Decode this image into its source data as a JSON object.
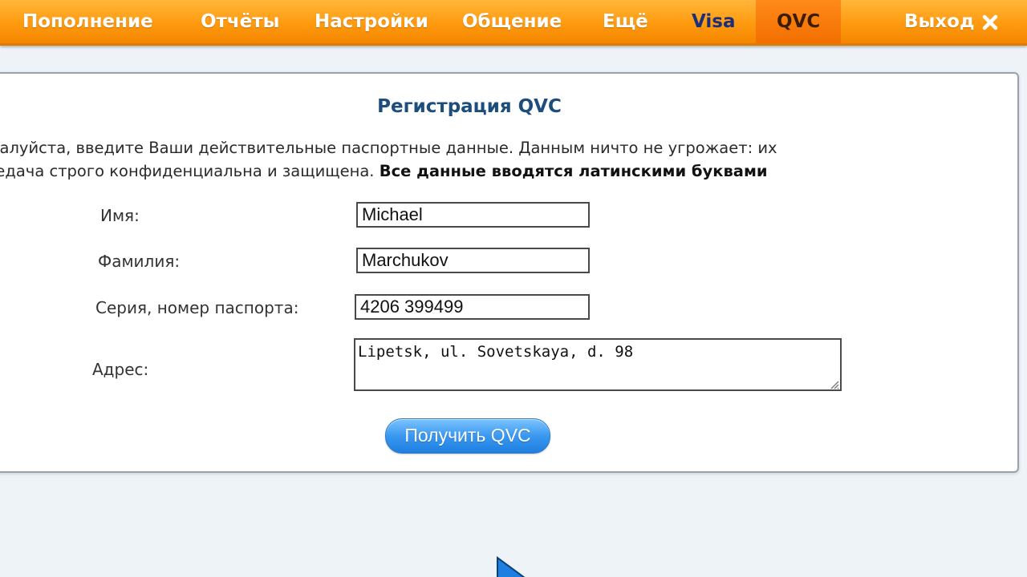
{
  "nav": {
    "items": [
      {
        "label": "Пополнение"
      },
      {
        "label": "Отчёты"
      },
      {
        "label": "Настройки"
      },
      {
        "label": "Общение"
      },
      {
        "label": "Ещё"
      },
      {
        "label": "Visa"
      },
      {
        "label": "QVC",
        "active": true
      }
    ],
    "exit_label": "Выход"
  },
  "form": {
    "title": "Регистрация QVC",
    "desc_line1": "ожалуйста, введите Ваши действительные паспортные данные. Данным ничто не угрожает: их",
    "desc_line2": "ередача строго конфиденциальна и защищена.",
    "desc_bold": "Все данные вводятся латинскими буквами",
    "fields": {
      "first_name": {
        "label": "Имя:",
        "value": "Michael"
      },
      "last_name": {
        "label": "Фамилия:",
        "value": "Marchukov"
      },
      "passport": {
        "label": "Серия, номер паспорта:",
        "value": "4206 399499"
      },
      "address": {
        "label": "Адрес:",
        "value": "Lipetsk, ul. Sovetskaya, d. 98"
      }
    },
    "submit_label": "Получить QVC"
  },
  "colors": {
    "nav_orange": "#ff9a0f",
    "title_blue": "#1c4d7d",
    "button_blue": "#3a98ef"
  }
}
